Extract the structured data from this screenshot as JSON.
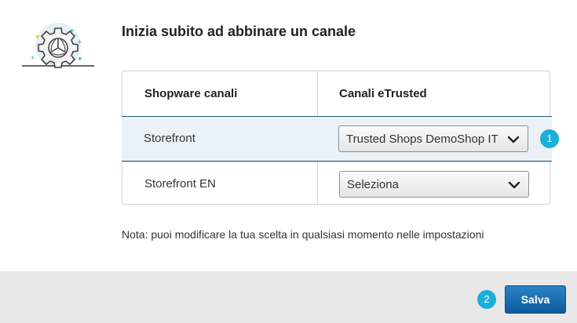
{
  "dialog": {
    "title": "Inizia subito ad abbinare un canale",
    "note": "Nota: puoi modificare la tua scelta in qualsiasi momento nelle impostazioni"
  },
  "table": {
    "headers": [
      "Shopware canali",
      "Canali eTrusted"
    ],
    "rows": [
      {
        "channel": "Storefront",
        "selected": "Trusted Shops DemoShop IT"
      },
      {
        "channel": "Storefront EN",
        "selected": "Seleziona"
      }
    ]
  },
  "steps": [
    "1",
    "2"
  ],
  "footer": {
    "save_label": "Salva"
  },
  "colors": {
    "accent": "#1ab0d9",
    "primary_button": "#0b5b9d",
    "selected_row_border": "#1f5a7c",
    "selected_row_bg": "#eaf2f8"
  },
  "icons": [
    "gear-illustration-icon",
    "chevron-down-icon"
  ]
}
